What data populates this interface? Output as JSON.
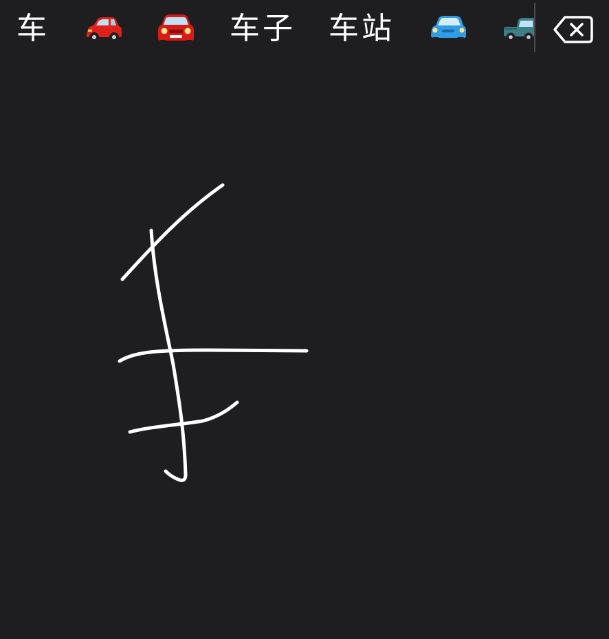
{
  "candidates": [
    {
      "type": "text",
      "label": "车"
    },
    {
      "type": "emoji",
      "icon": "red-car-side-icon",
      "color": "#e0201b"
    },
    {
      "type": "emoji",
      "icon": "red-car-front-icon",
      "color": "#d91a17"
    },
    {
      "type": "text",
      "label": "车子"
    },
    {
      "type": "text",
      "label": "车站"
    },
    {
      "type": "emoji",
      "icon": "blue-car-icon",
      "color": "#2f9de6"
    },
    {
      "type": "emoji",
      "icon": "teal-pickup-truck-icon",
      "color": "#3e7f86"
    }
  ],
  "delete_key": {
    "icon": "backspace-icon"
  },
  "theme": {
    "background": "#1e1d20",
    "text_color": "#ffffff",
    "ink_color": "#ffffff"
  }
}
